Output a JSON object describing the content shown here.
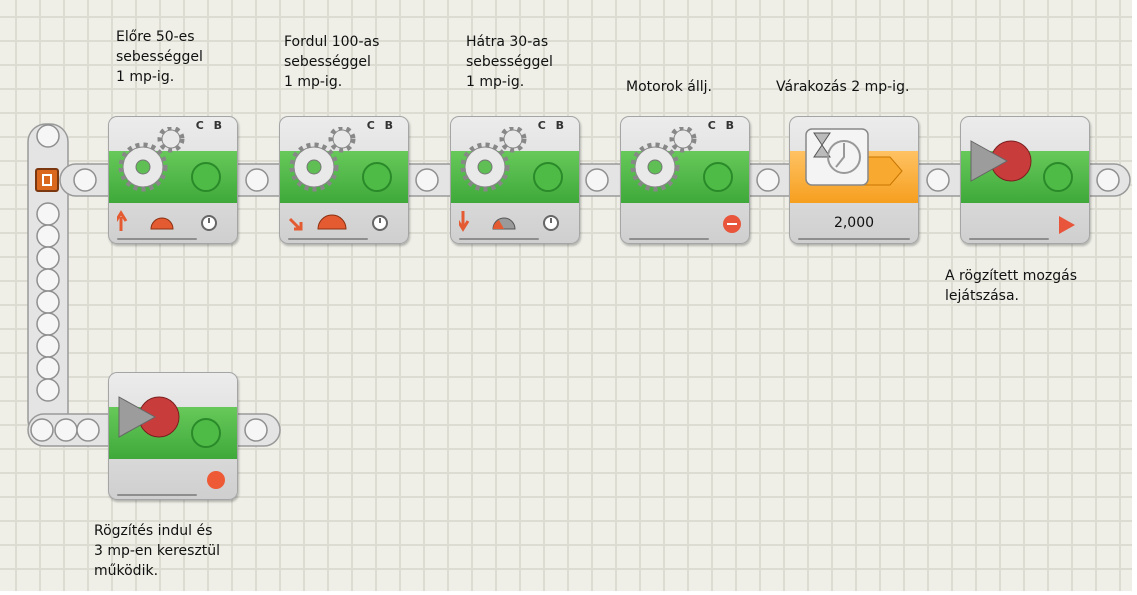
{
  "start_point": {
    "icon": "start-icon"
  },
  "blocks": [
    {
      "name": "move-block-1",
      "type": "move",
      "ports": "C B",
      "annotation": "Előre 50-es\nsebességgel\n1 mp-ig.",
      "icons": [
        "direction-forward-icon",
        "power-gauge-icon",
        "duration-clock-icon"
      ]
    },
    {
      "name": "move-block-2",
      "type": "move",
      "ports": "C B",
      "annotation": "Fordul 100-as\nsebességgel\n1 mp-ig.",
      "icons": [
        "direction-turn-icon",
        "power-gauge-icon",
        "duration-clock-icon"
      ]
    },
    {
      "name": "move-block-3",
      "type": "move",
      "ports": "C B",
      "annotation": "Hátra 30-as\nsebességgel\n1 mp-ig.",
      "icons": [
        "direction-backward-icon",
        "power-gauge-icon",
        "duration-clock-icon"
      ]
    },
    {
      "name": "move-block-4",
      "type": "move",
      "ports": "C B",
      "annotation": "Motorok állj.",
      "icons": [
        "stop-icon"
      ]
    },
    {
      "name": "wait-block",
      "type": "wait",
      "annotation": "Várakozás 2 mp-ig.",
      "value": "2,000",
      "icons": [
        "hourglass-icon"
      ]
    },
    {
      "name": "playback-block",
      "type": "record-play",
      "annotation": "A rögzített mozgás\nlejátszása.",
      "icons": [
        "play-icon"
      ]
    },
    {
      "name": "record-block",
      "type": "record-play",
      "annotation": "Rögzítés indul és\n3 mp-en keresztül\nműködik.",
      "icons": [
        "record-icon"
      ]
    }
  ],
  "colors": {
    "move_band": "#4cb944",
    "wait_band": "#f8a930",
    "accent_red": "#e8553a"
  }
}
